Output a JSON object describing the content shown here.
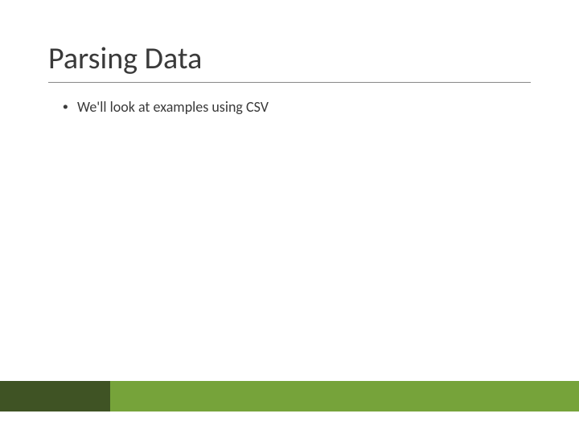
{
  "slide": {
    "title": "Parsing Data",
    "bullets": [
      "We'll look at examples using CSV"
    ]
  },
  "colors": {
    "footer_dark": "#3f5324",
    "footer_light": "#76a33a",
    "text": "#3a3a3a"
  }
}
